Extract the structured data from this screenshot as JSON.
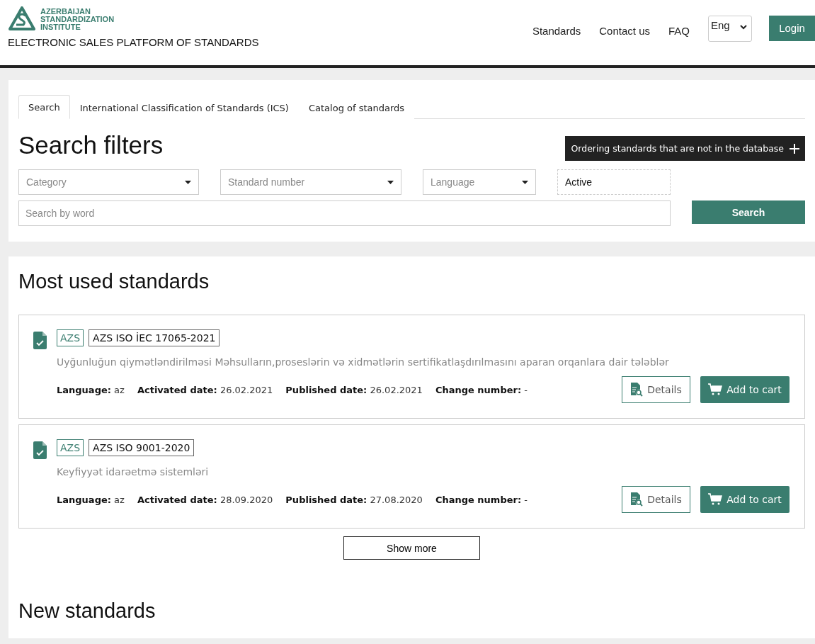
{
  "header": {
    "logo_lines": [
      "AZERBAIJAN",
      "STANDARDIZATION",
      "INSTITUTE"
    ],
    "platform_title": "ELECTRONIC SALES PLATFORM OF STANDARDS",
    "nav": [
      "Standards",
      "Contact us",
      "FAQ"
    ],
    "language": "Eng",
    "login": "Login"
  },
  "search_panel": {
    "tabs": [
      {
        "label": "Search",
        "selected": true
      },
      {
        "label": "International Classification of Standards (ICS)",
        "selected": false
      },
      {
        "label": "Catalog of standards",
        "selected": false
      }
    ],
    "title": "Search filters",
    "order_button": "Ordering standards that are not in the database",
    "filters": [
      {
        "kind": "dropdown",
        "placeholder": "Category"
      },
      {
        "kind": "dropdown",
        "placeholder": "Standard number"
      },
      {
        "kind": "dropdown",
        "placeholder": "Language"
      },
      {
        "kind": "status",
        "value": "Active"
      }
    ],
    "word_search": {
      "placeholder": "Search by word"
    },
    "search_button": "Search"
  },
  "most_used": {
    "title": "Most used standards",
    "items": [
      {
        "prefix": "AZS",
        "code": "AZS ISO İEC 17065-2021",
        "description": "Uyğunluğun qiymətləndirilməsi Məhsulların,proseslərin və xidmətlərin sertifikatlaşdırılmasını aparan orqanlara dair tələblər",
        "meta": [
          {
            "label": "Language:",
            "value": "az"
          },
          {
            "label": "Activated date:",
            "value": "26.02.2021"
          },
          {
            "label": "Published date:",
            "value": "26.02.2021"
          },
          {
            "label": "Change number:",
            "value": "-"
          }
        ],
        "details": "Details",
        "cart": "Add to cart"
      },
      {
        "prefix": "AZS",
        "code": "AZS ISO 9001-2020",
        "description": "Keyfiyyət idarəetmə sistemləri",
        "meta": [
          {
            "label": "Language:",
            "value": "az"
          },
          {
            "label": "Activated date:",
            "value": "28.09.2020"
          },
          {
            "label": "Published date:",
            "value": "27.08.2020"
          },
          {
            "label": "Change number:",
            "value": "-"
          }
        ],
        "details": "Details",
        "cart": "Add to cart"
      }
    ],
    "show_more": "Show more"
  },
  "new_standards": {
    "title": "New standards"
  }
}
